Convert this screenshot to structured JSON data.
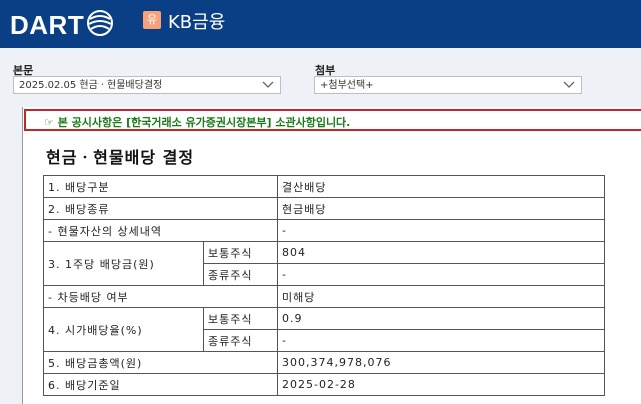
{
  "app": {
    "logo": "DART",
    "company_badge": "유",
    "company_name": "KB금융"
  },
  "main_select": {
    "label": "본문",
    "value": "2025.02.05  현금ㆍ현물배당결정"
  },
  "attach_select": {
    "label": "첨부",
    "value": "+첨부선택+"
  },
  "notice": {
    "text": "☞ 본 공시사항은 [한국거래소 유가증권시장본부] 소관사항입니다."
  },
  "document": {
    "title": "현금ㆍ현물배당 결정",
    "rows": {
      "r1": {
        "label": "1. 배당구분",
        "value": "결산배당"
      },
      "r2": {
        "label": "2. 배당종류",
        "value": "현금배당"
      },
      "r3": {
        "label": "- 현물자산의 상세내역",
        "value": "-"
      },
      "r4": {
        "label": "3. 1주당 배당금(원)",
        "sub1": "보통주식",
        "val1": "804",
        "sub2": "종류주식",
        "val2": "-"
      },
      "r5": {
        "label": "- 차등배당 여부",
        "value": "미해당"
      },
      "r6": {
        "label": "4. 시가배당율(%)",
        "sub1": "보통주식",
        "val1": "0.9",
        "sub2": "종류주식",
        "val2": "-"
      },
      "r7": {
        "label": "5. 배당금총액(원)",
        "value": "300,374,978,076"
      },
      "r8": {
        "label": "6. 배당기준일",
        "value": "2025-02-28"
      }
    }
  },
  "colors": {
    "header_bg": "#0a3f86",
    "notice_border": "#c0272d",
    "notice_text": "#1a7a1a"
  }
}
